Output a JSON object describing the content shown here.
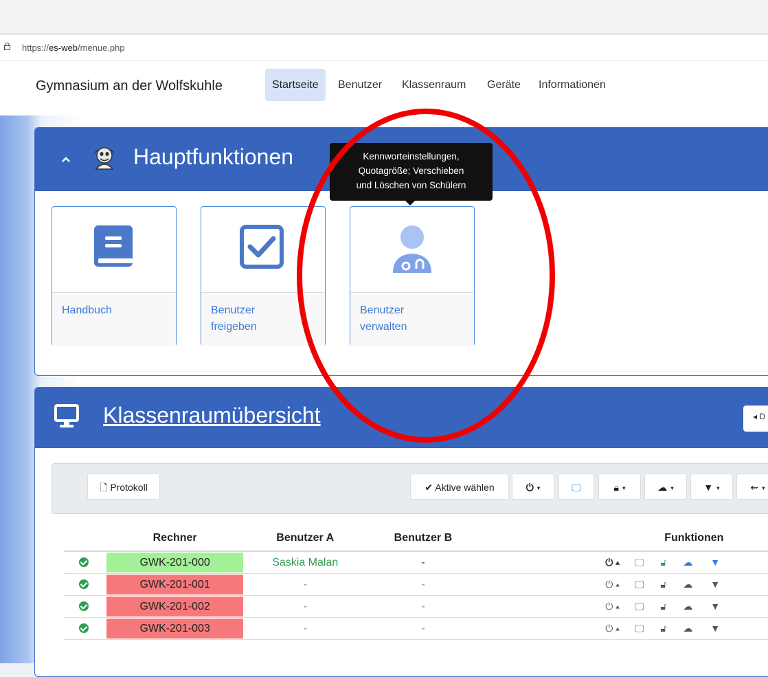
{
  "browser": {
    "url_prefix": "https://",
    "url_host": "es-web",
    "url_path": "/menue.php"
  },
  "navbar": {
    "brand": "Gymnasium an der Wolfskuhle",
    "items": [
      "Startseite",
      "Benutzer",
      "Klassenraum",
      "Geräte",
      "Informationen"
    ],
    "active": "Startseite"
  },
  "main_panel": {
    "title": "Hauptfunktionen",
    "tiles": [
      {
        "label_line1": "Handbuch",
        "label_line2": "",
        "icon": "book-icon"
      },
      {
        "label_line1": "Benutzer",
        "label_line2": "freigeben",
        "icon": "checkbox-icon"
      },
      {
        "label_line1": "Benutzer",
        "label_line2": "verwalten",
        "icon": "user-doctor-icon"
      }
    ],
    "tooltip": [
      "Kennworteinstellungen,",
      "Quotagröße; Verschieben",
      "und Löschen von Schülern"
    ]
  },
  "classroom": {
    "title": "Klassenraumübersicht",
    "toolbar": {
      "protokoll": "Protokoll",
      "select_active": "Aktive wählen"
    },
    "columns": [
      "Rechner",
      "Benutzer A",
      "Benutzer B",
      "Funktionen"
    ],
    "rows": [
      {
        "pc": "GWK-201-000",
        "user_a": "Saskia Malan",
        "user_b": "-",
        "state": "green"
      },
      {
        "pc": "GWK-201-001",
        "user_a": "-",
        "user_b": "-",
        "state": "red"
      },
      {
        "pc": "GWK-201-002",
        "user_a": "-",
        "user_b": "-",
        "state": "red"
      },
      {
        "pc": "GWK-201-003",
        "user_a": "-",
        "user_b": "-",
        "state": "red"
      }
    ]
  },
  "colors": {
    "header_blue": "#3764bd",
    "accent_blue": "#3b7bd6",
    "online_green": "#a4f099",
    "offline_red": "#f7787a",
    "annotation_red": "#f00000"
  }
}
